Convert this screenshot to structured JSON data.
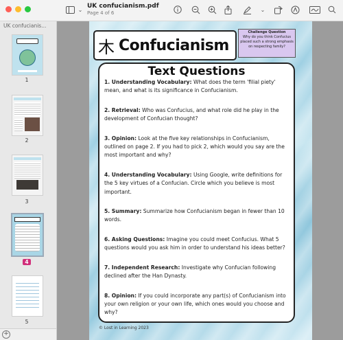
{
  "window": {
    "title": "UK confucianism.pdf",
    "subtitle": "Page 4 of 6"
  },
  "toolbar": {
    "icons": [
      "sidebar-toggle-icon",
      "info-icon",
      "zoom-out-icon",
      "zoom-in-icon",
      "share-icon",
      "highlight-icon",
      "chevron-down-icon",
      "rotate-icon",
      "markup-icon",
      "signature-icon",
      "search-icon"
    ]
  },
  "sidebar": {
    "title": "UK confucianis...",
    "thumbnails": [
      {
        "label": "1"
      },
      {
        "label": "2"
      },
      {
        "label": "3"
      },
      {
        "label": "4",
        "selected": true
      },
      {
        "label": "5"
      }
    ]
  },
  "page": {
    "title": "Confucianism",
    "logo_glyph": "⽊",
    "challenge": {
      "heading": "Challenge Question",
      "text": "Why do you think Confucius placed such a strong emphasis on respecting family?"
    },
    "card_title": "Text Questions",
    "questions": [
      {
        "lead": "1. Understanding Vocabulary:",
        "text": " What does the term 'filial piety' mean, and what is its significance in Confucianism."
      },
      {
        "lead": "2. Retrieval:",
        "text": " Who was Confucius, and what role did he play in the development of Confucian thought?"
      },
      {
        "lead": "3. Opinion:",
        "text": " Look at the five key relationships in Confucianism, outlined on page 2. If you had to pick 2, which would you say are the most important and why?"
      },
      {
        "lead": "4. Understanding Vocabulary:",
        "text": " Using Google, write definitions for the 5 key virtues of a Confucian. Circle which you believe is most important."
      },
      {
        "lead": "5. Summary:",
        "text": " Summarize how Confucianism began in fewer than 10 words."
      },
      {
        "lead": "6. Asking Questions:",
        "text": " Imagine you could meet Confucius. What 5 questions would you ask him in order to understand his ideas better?"
      },
      {
        "lead": "7. Independent Research:",
        "text": " Investigate why Confucian following declined after the Han Dynasty."
      },
      {
        "lead": "8. Opinion:",
        "text": " If you could incorporate any part(s) of Confucianism into your own religion or your own life, which ones would you choose and why?"
      }
    ],
    "footer": "© Lost in Learning 2023"
  },
  "colors": {
    "selected_badge": "#d12e7a",
    "challenge_box": "#d9c7ef",
    "page_bg": "#a9d6e6"
  }
}
